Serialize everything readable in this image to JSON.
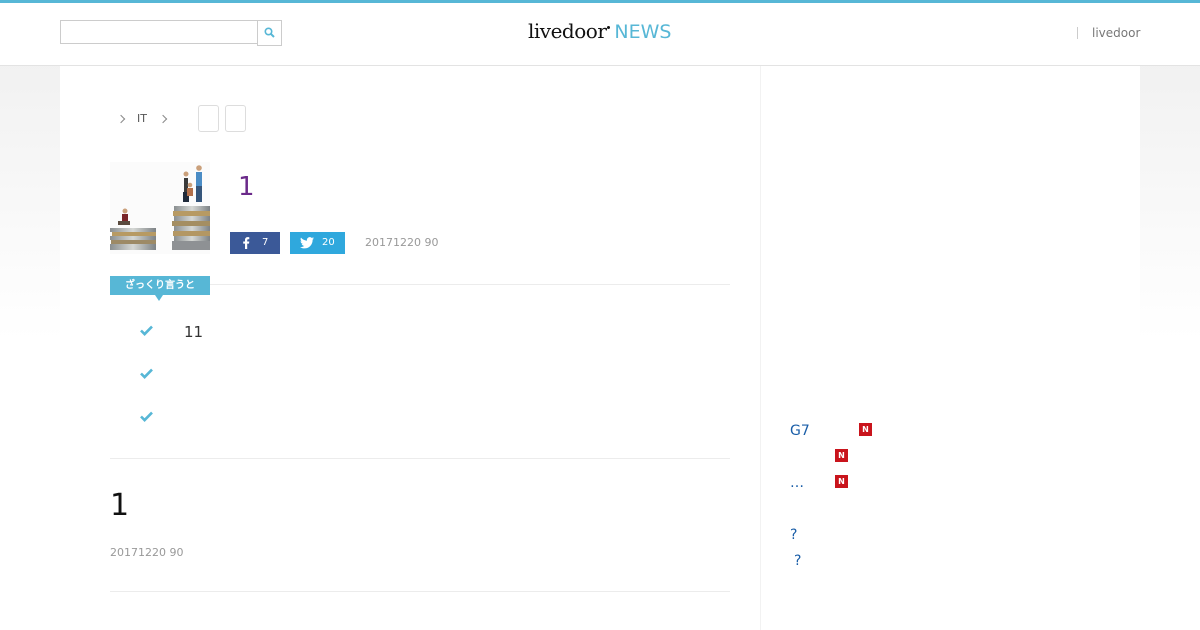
{
  "header": {
    "search_placeholder": "",
    "logo_main": "livedoor",
    "logo_sub": "NEWS",
    "link_label": "livedoor"
  },
  "breadcrumb": {
    "category": "IT"
  },
  "article": {
    "title": "1",
    "facebook_count": "7",
    "twitter_count": "20",
    "date": "20171220 90"
  },
  "summary": {
    "badge": "ざっくり言うと",
    "items": [
      "11",
      "",
      ""
    ]
  },
  "body": {
    "title": "1",
    "date": "20171220 90"
  },
  "sidebar": {
    "links": [
      {
        "label": "G7",
        "badge": "N"
      },
      {
        "label": "",
        "badge": "N"
      },
      {
        "label": "…",
        "badge": "N"
      },
      {
        "label": "?",
        "badge": ""
      },
      {
        "label": "?",
        "badge": ""
      }
    ]
  },
  "colors": {
    "accent": "#57b7d6",
    "facebook": "#3b5998",
    "twitter": "#2fa8dd",
    "new_badge": "#c9141c",
    "title": "#6b2a8a",
    "link": "#1a5ea8"
  },
  "icons": {
    "search": "search-icon",
    "facebook": "facebook-icon",
    "twitter": "twitter-icon",
    "check": "check-icon",
    "chevron": "chevron-right-icon"
  }
}
